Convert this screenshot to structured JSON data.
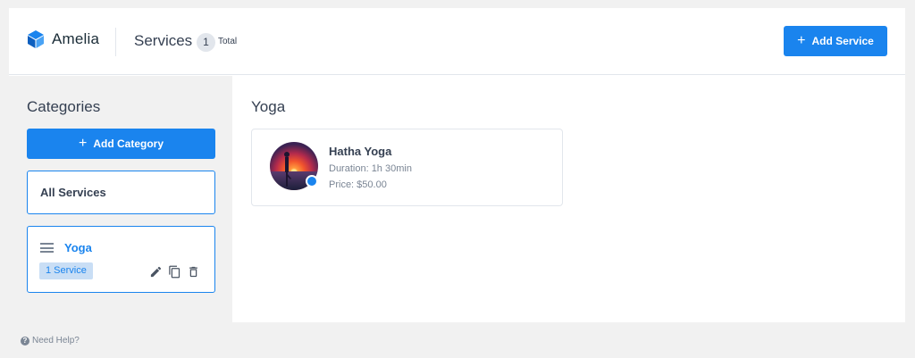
{
  "header": {
    "brand": "Amelia",
    "page_title": "Services",
    "count": "1",
    "count_label": "Total",
    "add_service_label": "Add Service"
  },
  "sidebar": {
    "heading": "Categories",
    "add_category_label": "Add Category",
    "all_services_label": "All Services",
    "categories": [
      {
        "name": "Yoga",
        "service_count_label": "1 Service"
      }
    ]
  },
  "main": {
    "category_title": "Yoga",
    "services": [
      {
        "name": "Hatha Yoga",
        "duration": "Duration: 1h 30min",
        "price": "Price: $50.00"
      }
    ]
  },
  "footer": {
    "help_label": "Need Help?"
  },
  "colors": {
    "accent": "#1a84ee",
    "sidebar_bg": "#f1f1f1",
    "tag_bg": "#c9def5"
  },
  "icons": {
    "logo": "amelia-logo-icon",
    "add": "plus-icon",
    "drag": "hamburger-icon",
    "edit": "pencil-icon",
    "duplicate": "copy-icon",
    "delete": "trash-icon",
    "help": "question-circle-icon"
  }
}
